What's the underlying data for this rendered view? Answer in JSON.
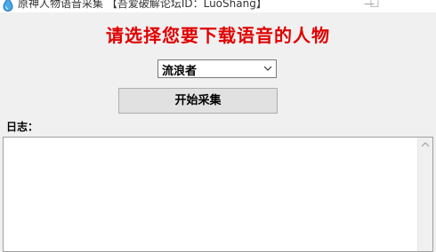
{
  "window": {
    "title": "原神人物语音采集  【吾爱破解论坛ID：LuoShang】",
    "minimize_glyph": "—",
    "maximize_glyph": "☐",
    "icon": "water-drop-icon"
  },
  "main": {
    "heading": "请选择您要下载语音的人物",
    "heading_color": "#e00000",
    "character_select": {
      "selected": "流浪者"
    },
    "start_button_label": "开始采集",
    "log_label": "日志：",
    "log_text": ""
  }
}
